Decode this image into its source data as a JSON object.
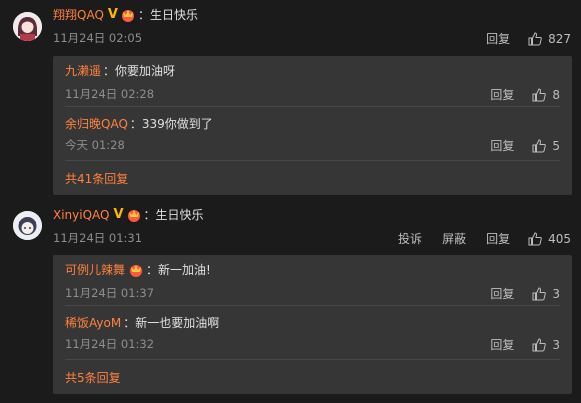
{
  "comments": [
    {
      "name": "翔翔QAQ",
      "text": "：生日快乐",
      "time": "11月24日 02:05",
      "reply_label": "回复",
      "likes": "827",
      "replies": [
        {
          "name": "九濑遥",
          "text": "：你要加油呀",
          "time": "11月24日 02:28",
          "reply_label": "回复",
          "likes": "8"
        },
        {
          "name": "余归晚QAQ",
          "text": "：339你做到了",
          "time": "今天 01:28",
          "reply_label": "回复",
          "likes": "5"
        }
      ],
      "more_label": "共41条回复"
    },
    {
      "name": "XinyiQAQ",
      "text": "：生日快乐",
      "time": "11月24日 01:31",
      "report_label": "投诉",
      "block_label": "屏蔽",
      "reply_label": "回复",
      "likes": "405",
      "replies": [
        {
          "name": "可例儿辣舞",
          "text": "：新一加油!",
          "time": "11月24日 01:37",
          "reply_label": "回复",
          "likes": "3"
        },
        {
          "name": "稀饭AyoM",
          "text": "：新一也要加油啊",
          "time": "11月24日 01:32",
          "reply_label": "回复",
          "likes": "3"
        }
      ],
      "more_label": "共5条回复"
    }
  ],
  "colors": {
    "background": "#1b1b1b",
    "reply_box": "#363636",
    "username": "#ff8140",
    "badge": "#ffb800"
  }
}
